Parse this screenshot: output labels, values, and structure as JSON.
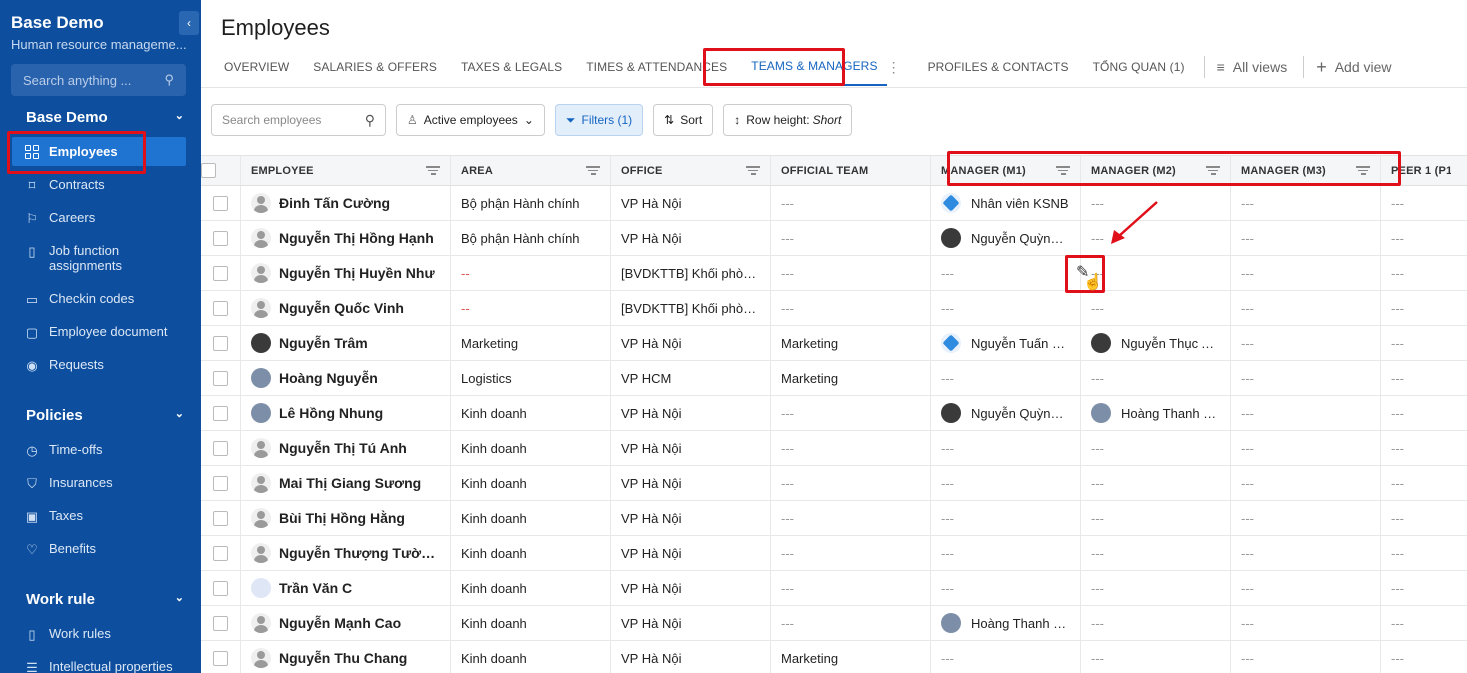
{
  "sidebar": {
    "title": "Base Demo",
    "subtitle": "Human resource manageme...",
    "search_placeholder": "Search anything ...",
    "sections": [
      {
        "label": "Base Demo"
      },
      {
        "label": "Policies"
      },
      {
        "label": "Work rule"
      }
    ],
    "items": [
      {
        "label": "Employees",
        "icon": "grid-icon"
      },
      {
        "label": "Contracts",
        "icon": "bookmark-icon"
      },
      {
        "label": "Careers",
        "icon": "flag-icon"
      },
      {
        "label": "Job function assignments",
        "icon": "book-icon"
      },
      {
        "label": "Checkin codes",
        "icon": "calendar-icon"
      },
      {
        "label": "Employee document",
        "icon": "document-icon"
      },
      {
        "label": "Requests",
        "icon": "broadcast-icon"
      },
      {
        "label": "Time-offs",
        "icon": "clock-icon"
      },
      {
        "label": "Insurances",
        "icon": "shield-icon"
      },
      {
        "label": "Taxes",
        "icon": "image-icon"
      },
      {
        "label": "Benefits",
        "icon": "heart-icon"
      },
      {
        "label": "Work rules",
        "icon": "book-icon"
      },
      {
        "label": "Intellectual properties",
        "icon": "list-icon"
      }
    ]
  },
  "header": {
    "title": "Employees",
    "tabs": [
      {
        "label": "OVERVIEW"
      },
      {
        "label": "SALARIES & OFFERS"
      },
      {
        "label": "TAXES & LEGALS"
      },
      {
        "label": "TIMES & ATTENDANCES"
      },
      {
        "label": "TEAMS & MANAGERS"
      },
      {
        "label": "PROFILES & CONTACTS"
      },
      {
        "label": "TỔNG QUAN (1)"
      }
    ],
    "all_views": "All views",
    "add_view": "Add view"
  },
  "toolbar": {
    "search_placeholder": "Search employees",
    "active_label": "Active employees",
    "filters_label": "Filters (1)",
    "sort_label": "Sort",
    "row_height_label": "Row height:",
    "row_height_value": "Short"
  },
  "table": {
    "columns": [
      "EMPLOYEE",
      "AREA",
      "OFFICE",
      "OFFICIAL TEAM",
      "MANAGER (M1)",
      "MANAGER (M2)",
      "MANAGER (M3)",
      "PEER 1 (P1"
    ],
    "rows": [
      {
        "name": "Đinh Tấn Cường",
        "avatar": "person",
        "area": "Bộ phận Hành chính",
        "office": "VP Hà Nội",
        "team": "---",
        "m1": {
          "name": "Nhân viên KSNB",
          "avatar": "logo"
        },
        "m2": null,
        "m3": null
      },
      {
        "name": "Nguyễn Thị Hồng Hạnh",
        "avatar": "person",
        "area": "Bộ phận Hành chính",
        "office": "VP Hà Nội",
        "team": "---",
        "m1": {
          "name": "Nguyễn Quỳnh ...",
          "avatar": "photo"
        },
        "m2": null,
        "m3": null
      },
      {
        "name": "Nguyễn Thị Huyền Như",
        "avatar": "person",
        "area": "--",
        "office": "[BVDKTTB] Khối phòn...",
        "team": "---",
        "m1": null,
        "m2": null,
        "m3": null
      },
      {
        "name": "Nguyễn Quốc Vinh",
        "avatar": "person",
        "area": "--",
        "office": "[BVDKTTB] Khối phòn...",
        "team": "---",
        "m1": null,
        "m2": null,
        "m3": null
      },
      {
        "name": "Nguyễn Trâm",
        "avatar": "photo",
        "area": "Marketing",
        "office": "VP Hà Nội",
        "team": "Marketing",
        "m1": {
          "name": "Nguyễn Tuấn D...",
          "avatar": "logo"
        },
        "m2": {
          "name": "Nguyễn Thục A...",
          "avatar": "photo"
        },
        "m3": null
      },
      {
        "name": "Hoàng Nguyễn",
        "avatar": "photo2",
        "area": "Logistics",
        "office": "VP HCM",
        "team": "Marketing",
        "m1": null,
        "m2": null,
        "m3": null
      },
      {
        "name": "Lê Hồng Nhung",
        "avatar": "photo2",
        "area": "Kinh doanh",
        "office": "VP Hà Nội",
        "team": "---",
        "m1": {
          "name": "Nguyễn Quỳnh ...",
          "avatar": "photo"
        },
        "m2": {
          "name": "Hoàng Thanh N...",
          "avatar": "photo2"
        },
        "m3": null
      },
      {
        "name": "Nguyễn Thị Tú Anh",
        "avatar": "person",
        "area": "Kinh doanh",
        "office": "VP Hà Nội",
        "team": "---",
        "m1": null,
        "m2": null,
        "m3": null
      },
      {
        "name": "Mai Thị Giang Sương",
        "avatar": "person",
        "area": "Kinh doanh",
        "office": "VP Hà Nội",
        "team": "---",
        "m1": null,
        "m2": null,
        "m3": null
      },
      {
        "name": "Bùi Thị Hồng Hằng",
        "avatar": "person",
        "area": "Kinh doanh",
        "office": "VP Hà Nội",
        "team": "---",
        "m1": null,
        "m2": null,
        "m3": null
      },
      {
        "name": "Nguyễn Thượng Tường ...",
        "avatar": "person",
        "area": "Kinh doanh",
        "office": "VP Hà Nội",
        "team": "---",
        "m1": null,
        "m2": null,
        "m3": null
      },
      {
        "name": "Trần Văn C",
        "avatar": "light",
        "area": "Kinh doanh",
        "office": "VP Hà Nội",
        "team": "---",
        "m1": null,
        "m2": null,
        "m3": null
      },
      {
        "name": "Nguyễn Mạnh Cao",
        "avatar": "person",
        "area": "Kinh doanh",
        "office": "VP Hà Nội",
        "team": "---",
        "m1": {
          "name": "Hoàng Thanh N...",
          "avatar": "photo2"
        },
        "m2": null,
        "m3": null
      },
      {
        "name": "Nguyễn Thu Chang",
        "avatar": "person",
        "area": "Kinh doanh",
        "office": "VP Hà Nội",
        "team": "Marketing",
        "m1": null,
        "m2": null,
        "m3": null
      }
    ],
    "empty": "---"
  },
  "colors": {
    "sidebar_bg": "#0d4f9e",
    "accent": "#1565c0",
    "highlight": "#e0101a"
  }
}
